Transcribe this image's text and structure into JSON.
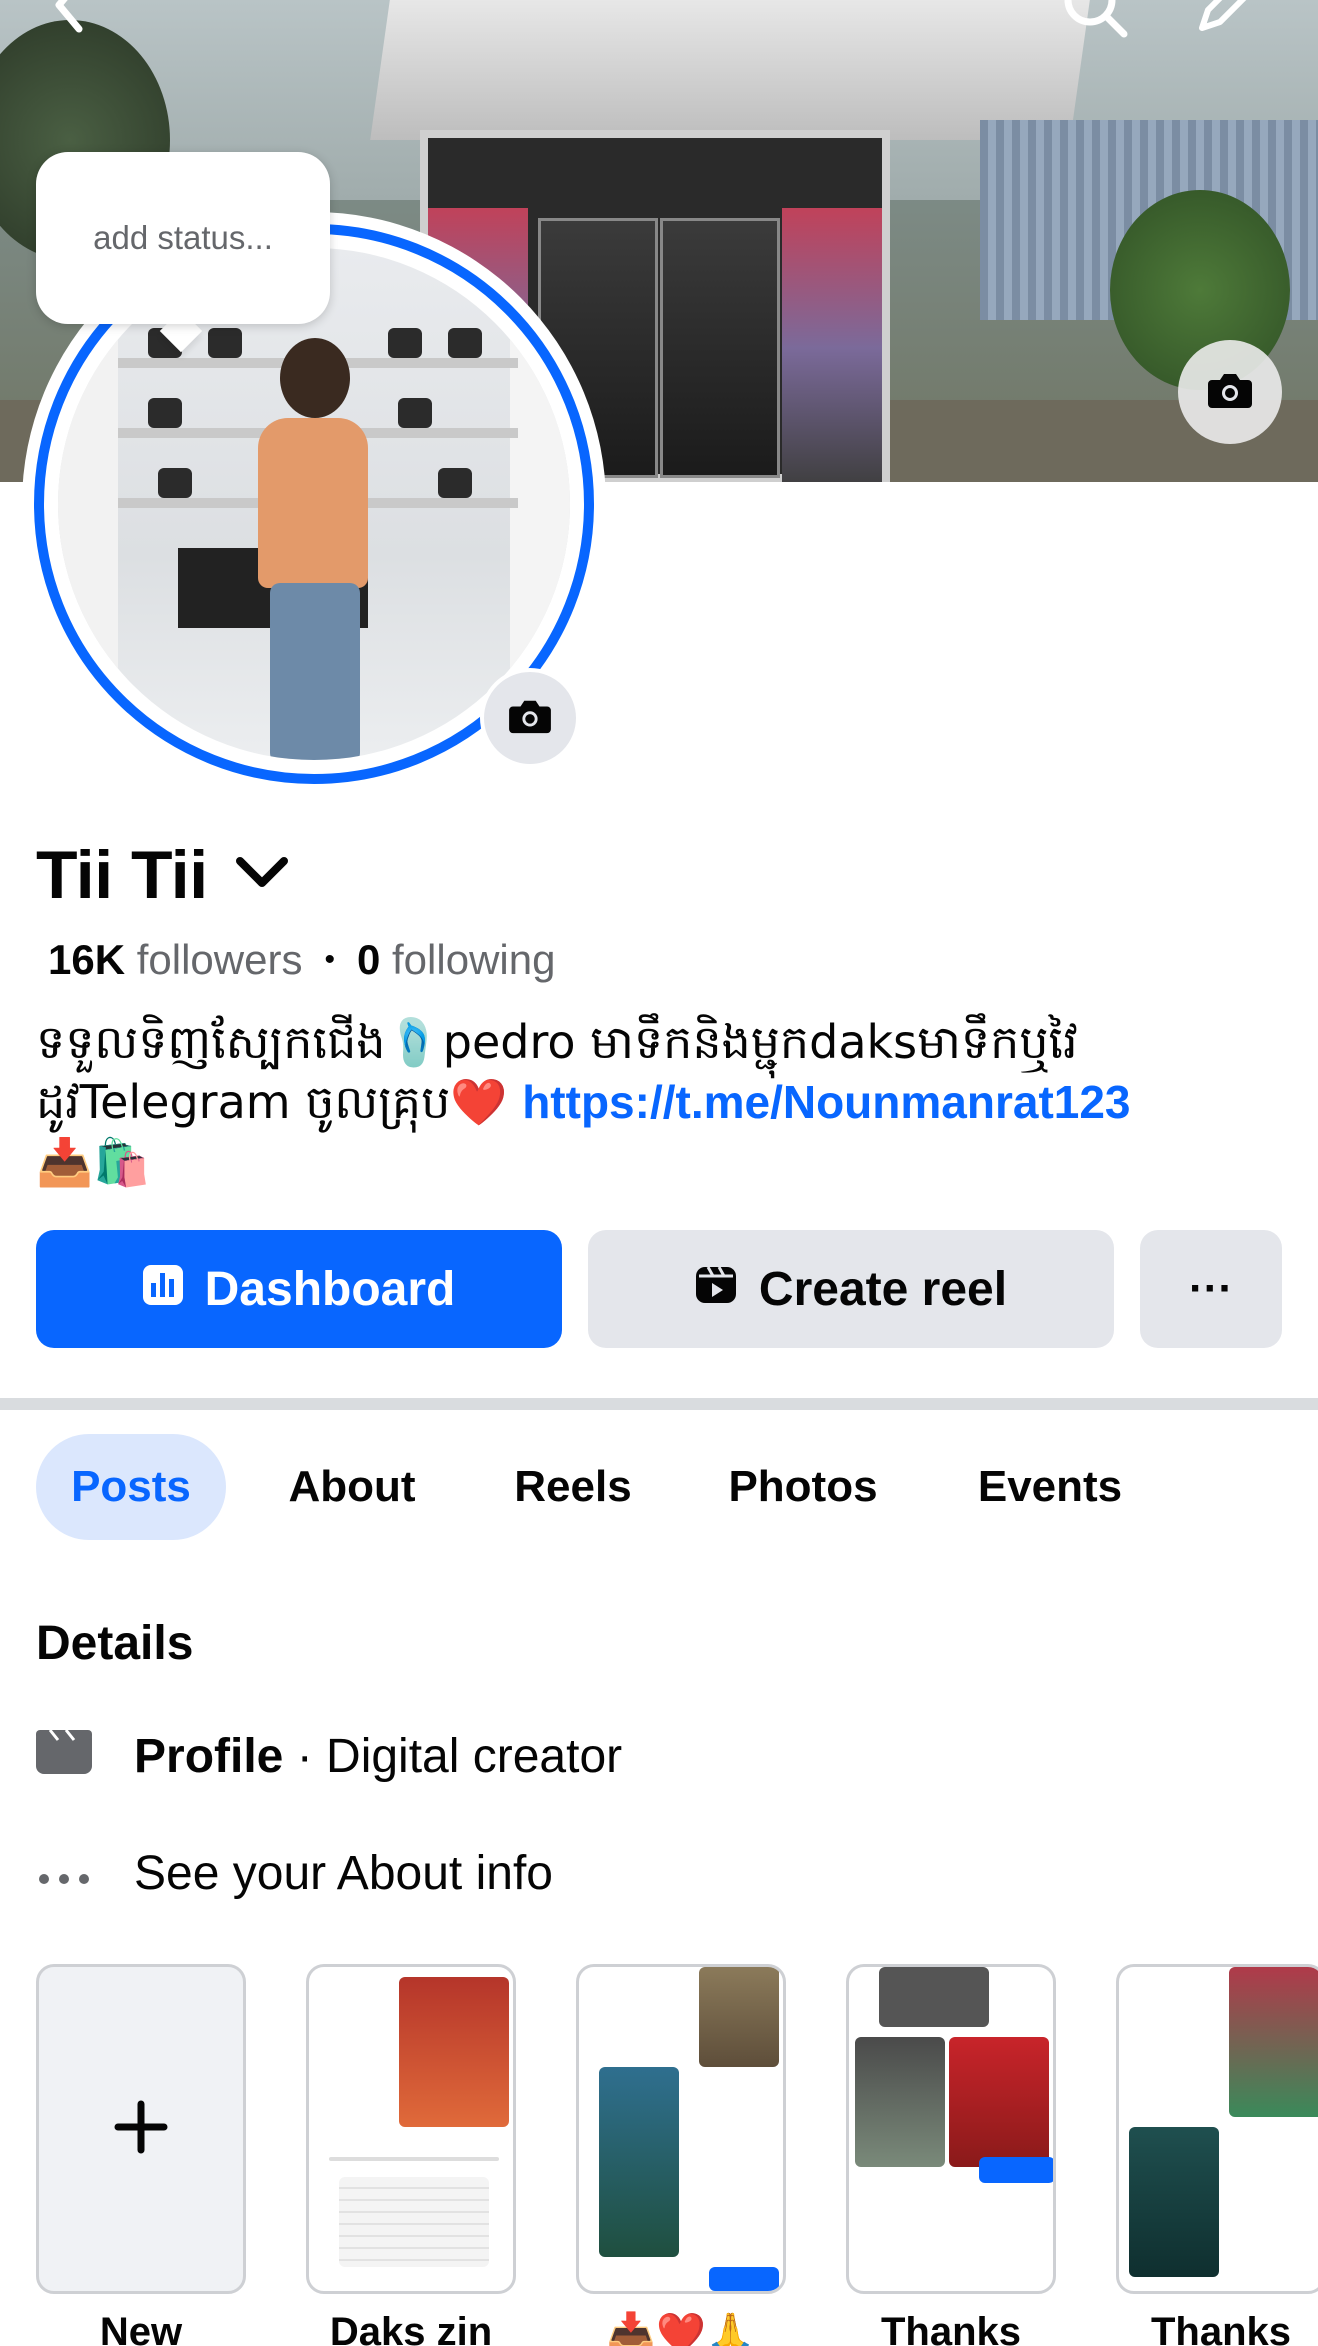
{
  "header": {
    "back_icon": "chevron-left-icon",
    "search_icon": "search-icon",
    "edit_icon": "pencil-icon"
  },
  "profile": {
    "status_placeholder": "add status...",
    "name": "Tii Tii",
    "followers_count": "16K",
    "followers_label": "followers",
    "separator": "•",
    "following_count": "0",
    "following_label": "following",
    "bio_line1": "ទទួលទិញស្បែកជើង🩴pedro មាទឹកនិងម្ជុកdaksមាទឹកឬវៃ",
    "bio_line2_prefix": "ដូវTelegram ចូលគ្រុប❤️ ",
    "bio_link": "https://t.me/Nounmanrat123",
    "bio_line3": "📥🛍️"
  },
  "actions": {
    "dashboard_label": "Dashboard",
    "create_reel_label": "Create reel",
    "more_label": "···"
  },
  "tabs": [
    {
      "label": "Posts",
      "active": true
    },
    {
      "label": "About",
      "active": false
    },
    {
      "label": "Reels",
      "active": false
    },
    {
      "label": "Photos",
      "active": false
    },
    {
      "label": "Events",
      "active": false
    }
  ],
  "details": {
    "title": "Details",
    "profile_bold": "Profile",
    "profile_rest": " · Digital creator",
    "about_link": "See your About info"
  },
  "stories": [
    {
      "label": "New"
    },
    {
      "label": "Daks zin"
    },
    {
      "label": "📥❤️🙏"
    },
    {
      "label": "Thanks"
    },
    {
      "label": "Thanks"
    }
  ],
  "colors": {
    "accent": "#0866ff",
    "button_gray": "#e4e6eb",
    "tab_active_bg": "#dbe7fd",
    "secondary_text": "#65676b"
  }
}
